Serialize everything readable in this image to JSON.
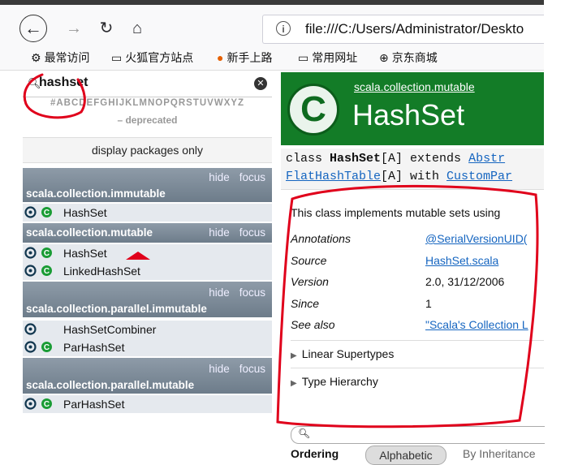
{
  "browser": {
    "url": "file:///C:/Users/Administrator/Deskto",
    "bookmarks": [
      "最常访问",
      "火狐官方站点",
      "新手上路",
      "常用网址",
      "京东商城"
    ]
  },
  "sidebar": {
    "search_value": "hashset",
    "letters": "#ABCDEFGHIJKLMNOPQRSTUVWXYZ",
    "deprecated": "– deprecated",
    "display_packages": "display packages only",
    "hide": "hide",
    "focus": "focus",
    "packages": [
      {
        "name": "scala.collection.immutable",
        "entries": [
          {
            "name": "HashSet",
            "object": true,
            "class": true
          }
        ]
      },
      {
        "name": "scala.collection.mutable",
        "entries": [
          {
            "name": "HashSet",
            "object": true,
            "class": true
          },
          {
            "name": "LinkedHashSet",
            "object": true,
            "class": true
          }
        ]
      },
      {
        "name": "scala.collection.parallel.immutable",
        "entries": [
          {
            "name": "HashSetCombiner",
            "object": true,
            "class": false
          },
          {
            "name": "ParHashSet",
            "object": true,
            "class": true
          }
        ]
      },
      {
        "name": "scala.collection.parallel.mutable",
        "entries": [
          {
            "name": "ParHashSet",
            "object": true,
            "class": true
          }
        ]
      }
    ]
  },
  "main": {
    "package_link": "scala.collection.mutable",
    "class_name": "HashSet",
    "signature_line1": {
      "kw": "class ",
      "name": "HashSet",
      "tparam": "[A] extends ",
      "link": "Abstr"
    },
    "signature_line2": {
      "link1": "FlatHashTable",
      "mid": "[A] with ",
      "link2": "CustomPar"
    },
    "description": "This class implements mutable sets using",
    "attributes": [
      {
        "key": "Annotations",
        "value": "@SerialVersionUID(",
        "link": true
      },
      {
        "key": "Source",
        "value": "HashSet.scala",
        "link": true
      },
      {
        "key": "Version",
        "value": "2.0, 31/12/2006",
        "link": false
      },
      {
        "key": "Since",
        "value": "1",
        "link": false
      },
      {
        "key": "See also",
        "value": "\"Scala's Collection L",
        "link": true
      }
    ],
    "linear_supertypes": "Linear Supertypes",
    "type_hierarchy": "Type Hierarchy",
    "ordering_label": "Ordering",
    "ordering_alpha": "Alphabetic",
    "ordering_inherit": "By Inheritance"
  },
  "colors": {
    "header_green": "#137c27",
    "package_bar": "#7b8896",
    "link_blue": "#1565c0",
    "annotation_red": "#e0001b"
  }
}
